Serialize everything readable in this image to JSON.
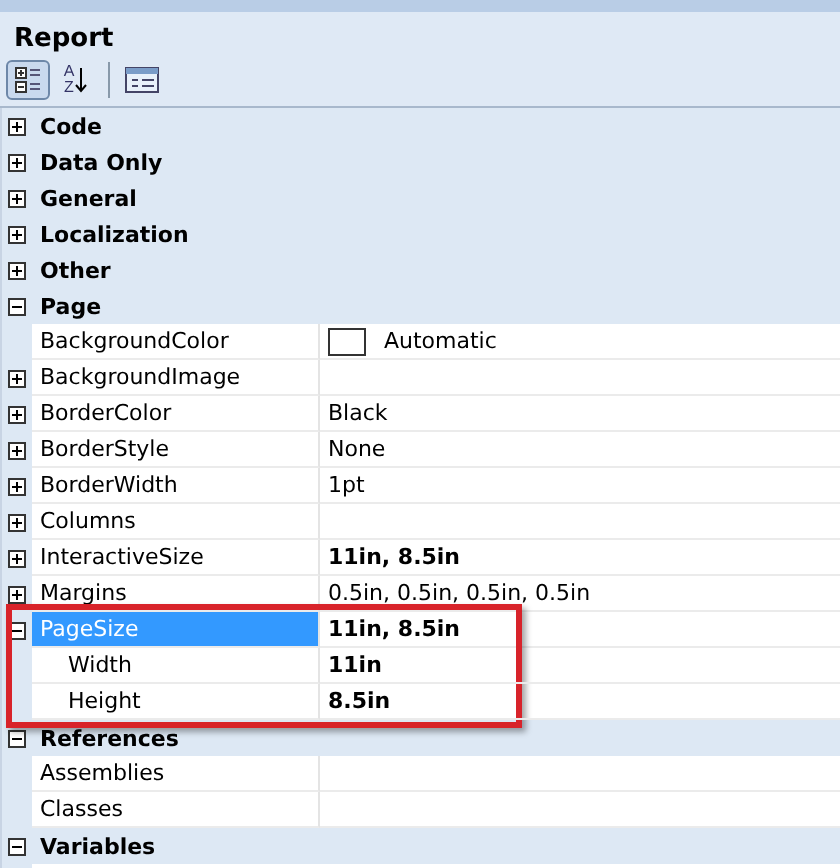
{
  "header": {
    "title": "Report"
  },
  "toolbar": [
    {
      "kind": "categorized",
      "selected": true
    },
    {
      "kind": "alphabetical",
      "selected": false,
      "glyphs": [
        "A",
        "Z"
      ]
    },
    {
      "kind": "pages",
      "selected": false
    }
  ],
  "categories": [
    {
      "label": "Code",
      "expanded": false,
      "selected": false
    },
    {
      "label": "Data Only",
      "expanded": false,
      "selected": false
    },
    {
      "label": "General",
      "expanded": false,
      "selected": false
    },
    {
      "label": "Localization",
      "expanded": false,
      "selected": false
    },
    {
      "label": "Other",
      "expanded": false,
      "selected": false
    },
    {
      "label": "Page",
      "expanded": true,
      "selected": false,
      "properties": [
        {
          "kind": "color",
          "label": "BackgroundColor",
          "value": "Automatic",
          "selected": false
        },
        {
          "kind": "text",
          "label": "BackgroundImage",
          "expanded": false,
          "selected": false
        },
        {
          "kind": "text",
          "label": "BorderColor",
          "value": "Black",
          "expanded": false,
          "selected": false
        },
        {
          "kind": "text",
          "label": "BorderStyle",
          "value": "None",
          "expanded": false,
          "selected": false
        },
        {
          "kind": "text",
          "label": "BorderWidth",
          "value": "1pt",
          "expanded": false,
          "selected": false
        },
        {
          "kind": "text",
          "label": "Columns",
          "expanded": false,
          "selected": false
        },
        {
          "kind": "text",
          "label": "InteractiveSize",
          "value": "11in, 8.5in",
          "expanded": false,
          "non_default": true,
          "selected": false
        },
        {
          "kind": "text",
          "label": "Margins",
          "value": "0.5in, 0.5in, 0.5in, 0.5in",
          "expanded": false,
          "selected": false
        },
        {
          "kind": "text",
          "label": "PageSize",
          "value": "11in, 8.5in",
          "expanded": true,
          "non_default": true,
          "selected": true,
          "highlighted": true,
          "children": [
            {
              "label": "Width",
              "value": "11in",
              "non_default": true,
              "selected": false
            },
            {
              "label": "Height",
              "value": "8.5in",
              "non_default": true,
              "selected": false
            }
          ]
        }
      ]
    },
    {
      "label": "References",
      "expanded": true,
      "selected": false,
      "properties": [
        {
          "kind": "text",
          "label": "Assemblies",
          "selected": false
        },
        {
          "kind": "text",
          "label": "Classes",
          "selected": false
        }
      ]
    },
    {
      "label": "Variables",
      "expanded": true,
      "selected": false
    }
  ]
}
